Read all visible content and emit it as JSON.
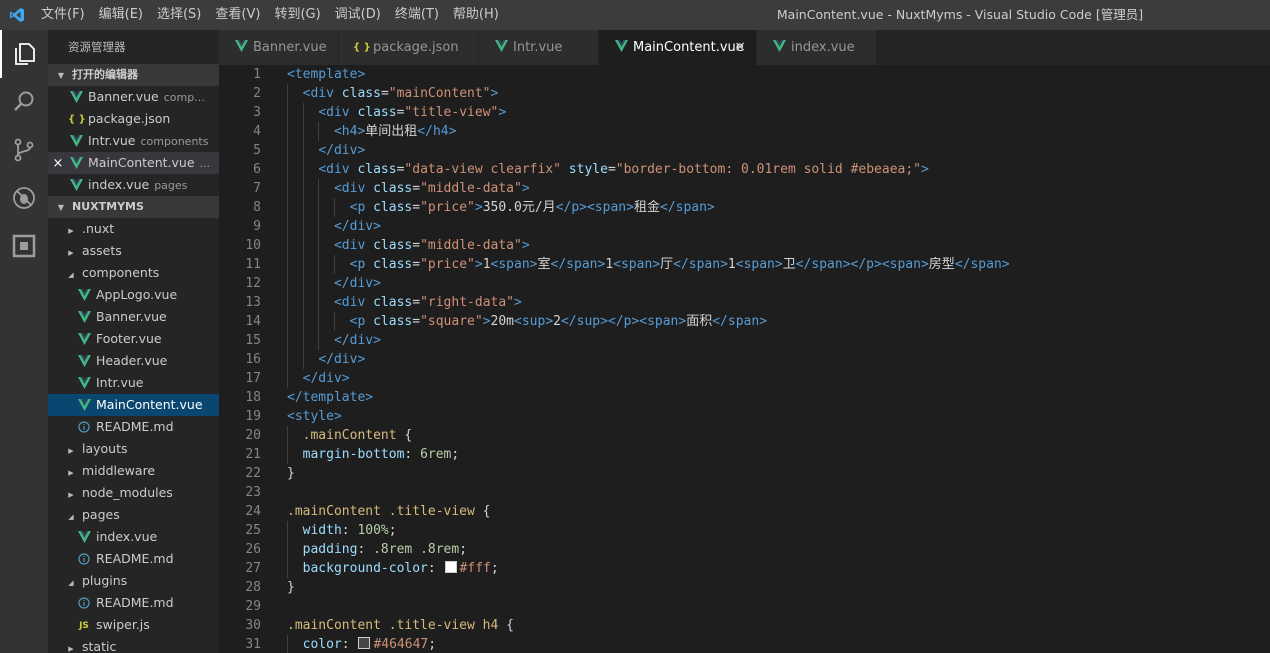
{
  "menu": [
    "文件(F)",
    "编辑(E)",
    "选择(S)",
    "查看(V)",
    "转到(G)",
    "调试(D)",
    "终端(T)",
    "帮助(H)"
  ],
  "window_title": "MainContent.vue - NuxtMyms - Visual Studio Code [管理员]",
  "activity_icons": [
    "explorer-icon",
    "search-icon",
    "source-control-icon",
    "debug-icon",
    "extensions-icon"
  ],
  "explorer": {
    "title": "资源管理器",
    "open_editors_header": "打开的编辑器",
    "open_editors": [
      {
        "name": "Banner.vue",
        "desc": "comp...",
        "icon": "vue"
      },
      {
        "name": "package.json",
        "desc": "",
        "icon": "json"
      },
      {
        "name": "Intr.vue",
        "desc": "components",
        "icon": "vue"
      },
      {
        "name": "MainContent.vue",
        "desc": "...",
        "icon": "vue"
      },
      {
        "name": "index.vue",
        "desc": "pages",
        "icon": "vue"
      }
    ],
    "project_header": "NUXTMYMS",
    "tree": [
      {
        "name": ".nuxt",
        "type": "folder",
        "depth": 0,
        "open": false
      },
      {
        "name": "assets",
        "type": "folder",
        "depth": 0,
        "open": false
      },
      {
        "name": "components",
        "type": "folder",
        "depth": 0,
        "open": true
      },
      {
        "name": "AppLogo.vue",
        "type": "vue",
        "depth": 1
      },
      {
        "name": "Banner.vue",
        "type": "vue",
        "depth": 1
      },
      {
        "name": "Footer.vue",
        "type": "vue",
        "depth": 1
      },
      {
        "name": "Header.vue",
        "type": "vue",
        "depth": 1
      },
      {
        "name": "Intr.vue",
        "type": "vue",
        "depth": 1
      },
      {
        "name": "MainContent.vue",
        "type": "vue",
        "depth": 1
      },
      {
        "name": "README.md",
        "type": "md",
        "depth": 1
      },
      {
        "name": "layouts",
        "type": "folder",
        "depth": 0,
        "open": false
      },
      {
        "name": "middleware",
        "type": "folder",
        "depth": 0,
        "open": false
      },
      {
        "name": "node_modules",
        "type": "folder",
        "depth": 0,
        "open": false
      },
      {
        "name": "pages",
        "type": "folder",
        "depth": 0,
        "open": true
      },
      {
        "name": "index.vue",
        "type": "vue",
        "depth": 1
      },
      {
        "name": "README.md",
        "type": "md",
        "depth": 1
      },
      {
        "name": "plugins",
        "type": "folder",
        "depth": 0,
        "open": true
      },
      {
        "name": "README.md",
        "type": "md",
        "depth": 1
      },
      {
        "name": "swiper.js",
        "type": "js",
        "depth": 1
      },
      {
        "name": "static",
        "type": "folder",
        "depth": 0,
        "open": false
      }
    ]
  },
  "tabs": [
    {
      "label": "Banner.vue",
      "icon": "vue"
    },
    {
      "label": "package.json",
      "icon": "json"
    },
    {
      "label": "Intr.vue",
      "icon": "vue"
    },
    {
      "label": "MainContent.vue",
      "icon": "vue",
      "active": true
    },
    {
      "label": "index.vue",
      "icon": "vue"
    }
  ],
  "tab_close_glyph": "×",
  "colors": {
    "vue": "#41b883",
    "json": "#cbcb41",
    "js": "#cbcb41",
    "md": "#519aba",
    "active_selection": "#094771"
  },
  "code_lines": [
    [
      [
        "tag",
        "<template>"
      ]
    ],
    [
      [
        "ws",
        "  "
      ],
      [
        "tag",
        "<div "
      ],
      [
        "attr",
        "class"
      ],
      [
        "txt",
        "="
      ],
      [
        "str",
        "\"mainContent\""
      ],
      [
        "tag",
        ">"
      ]
    ],
    [
      [
        "ws",
        "    "
      ],
      [
        "tag",
        "<div "
      ],
      [
        "attr",
        "class"
      ],
      [
        "txt",
        "="
      ],
      [
        "str",
        "\"title-view\""
      ],
      [
        "tag",
        ">"
      ]
    ],
    [
      [
        "ws",
        "      "
      ],
      [
        "tag",
        "<h4>"
      ],
      [
        "txt",
        "单间出租"
      ],
      [
        "tag",
        "</h4>"
      ]
    ],
    [
      [
        "ws",
        "    "
      ],
      [
        "tag",
        "</div>"
      ]
    ],
    [
      [
        "ws",
        "    "
      ],
      [
        "tag",
        "<div "
      ],
      [
        "attr",
        "class"
      ],
      [
        "txt",
        "="
      ],
      [
        "str",
        "\"data-view clearfix\" "
      ],
      [
        "attr",
        "style"
      ],
      [
        "txt",
        "="
      ],
      [
        "str",
        "\"border-bottom: 0.01rem solid #ebeaea;\""
      ],
      [
        "tag",
        ">"
      ]
    ],
    [
      [
        "ws",
        "      "
      ],
      [
        "tag",
        "<div "
      ],
      [
        "attr",
        "class"
      ],
      [
        "txt",
        "="
      ],
      [
        "str",
        "\"middle-data\""
      ],
      [
        "tag",
        ">"
      ]
    ],
    [
      [
        "ws",
        "        "
      ],
      [
        "tag",
        "<p "
      ],
      [
        "attr",
        "class"
      ],
      [
        "txt",
        "="
      ],
      [
        "str",
        "\"price\""
      ],
      [
        "tag",
        ">"
      ],
      [
        "txt",
        "350.0元/月"
      ],
      [
        "tag",
        "</p><span>"
      ],
      [
        "txt",
        "租金"
      ],
      [
        "tag",
        "</span>"
      ]
    ],
    [
      [
        "ws",
        "      "
      ],
      [
        "tag",
        "</div>"
      ]
    ],
    [
      [
        "ws",
        "      "
      ],
      [
        "tag",
        "<div "
      ],
      [
        "attr",
        "class"
      ],
      [
        "txt",
        "="
      ],
      [
        "str",
        "\"middle-data\""
      ],
      [
        "tag",
        ">"
      ]
    ],
    [
      [
        "ws",
        "        "
      ],
      [
        "tag",
        "<p "
      ],
      [
        "attr",
        "class"
      ],
      [
        "txt",
        "="
      ],
      [
        "str",
        "\"price\""
      ],
      [
        "tag",
        ">"
      ],
      [
        "txt",
        "1"
      ],
      [
        "tag",
        "<span>"
      ],
      [
        "txt",
        "室"
      ],
      [
        "tag",
        "</span>"
      ],
      [
        "txt",
        "1"
      ],
      [
        "tag",
        "<span>"
      ],
      [
        "txt",
        "厅"
      ],
      [
        "tag",
        "</span>"
      ],
      [
        "txt",
        "1"
      ],
      [
        "tag",
        "<span>"
      ],
      [
        "txt",
        "卫"
      ],
      [
        "tag",
        "</span></p><span>"
      ],
      [
        "txt",
        "房型"
      ],
      [
        "tag",
        "</span>"
      ]
    ],
    [
      [
        "ws",
        "      "
      ],
      [
        "tag",
        "</div>"
      ]
    ],
    [
      [
        "ws",
        "      "
      ],
      [
        "tag",
        "<div "
      ],
      [
        "attr",
        "class"
      ],
      [
        "txt",
        "="
      ],
      [
        "str",
        "\"right-data\""
      ],
      [
        "tag",
        ">"
      ]
    ],
    [
      [
        "ws",
        "        "
      ],
      [
        "tag",
        "<p "
      ],
      [
        "attr",
        "class"
      ],
      [
        "txt",
        "="
      ],
      [
        "str",
        "\"square\""
      ],
      [
        "tag",
        ">"
      ],
      [
        "txt",
        "20m"
      ],
      [
        "tag",
        "<sup>"
      ],
      [
        "txt",
        "2"
      ],
      [
        "tag",
        "</sup></p><span>"
      ],
      [
        "txt",
        "面积"
      ],
      [
        "tag",
        "</span>"
      ]
    ],
    [
      [
        "ws",
        "      "
      ],
      [
        "tag",
        "</div>"
      ]
    ],
    [
      [
        "ws",
        "    "
      ],
      [
        "tag",
        "</div>"
      ]
    ],
    [
      [
        "ws",
        "  "
      ],
      [
        "tag",
        "</div>"
      ]
    ],
    [
      [
        "tag",
        "</template>"
      ]
    ],
    [
      [
        "tag",
        "<style>"
      ]
    ],
    [
      [
        "ws",
        "  "
      ],
      [
        "sel",
        ".mainContent"
      ],
      [
        "txt",
        " {"
      ]
    ],
    [
      [
        "ws",
        "  "
      ],
      [
        "prop",
        "margin-bottom"
      ],
      [
        "txt",
        ": "
      ],
      [
        "num",
        "6rem"
      ],
      [
        "txt",
        ";"
      ]
    ],
    [
      [
        "txt",
        "}"
      ]
    ],
    [],
    [
      [
        "sel",
        ".mainContent .title-view"
      ],
      [
        "txt",
        " {"
      ]
    ],
    [
      [
        "ws",
        "  "
      ],
      [
        "prop",
        "width"
      ],
      [
        "txt",
        ": "
      ],
      [
        "num",
        "100%"
      ],
      [
        "txt",
        ";"
      ]
    ],
    [
      [
        "ws",
        "  "
      ],
      [
        "prop",
        "padding"
      ],
      [
        "txt",
        ": "
      ],
      [
        "num",
        ".8rem .8rem"
      ],
      [
        "txt",
        ";"
      ]
    ],
    [
      [
        "ws",
        "  "
      ],
      [
        "prop",
        "background-color"
      ],
      [
        "txt",
        ": "
      ],
      [
        "swatch",
        "#ffffff"
      ],
      [
        "str",
        "#fff"
      ],
      [
        "txt",
        ";"
      ]
    ],
    [
      [
        "txt",
        "}"
      ]
    ],
    [],
    [
      [
        "sel",
        ".mainContent .title-view h4"
      ],
      [
        "txt",
        " {"
      ]
    ],
    [
      [
        "ws",
        "  "
      ],
      [
        "prop",
        "color"
      ],
      [
        "txt",
        ": "
      ],
      [
        "swatch",
        "#464647"
      ],
      [
        "str",
        "#464647"
      ],
      [
        "txt",
        ";"
      ]
    ]
  ]
}
